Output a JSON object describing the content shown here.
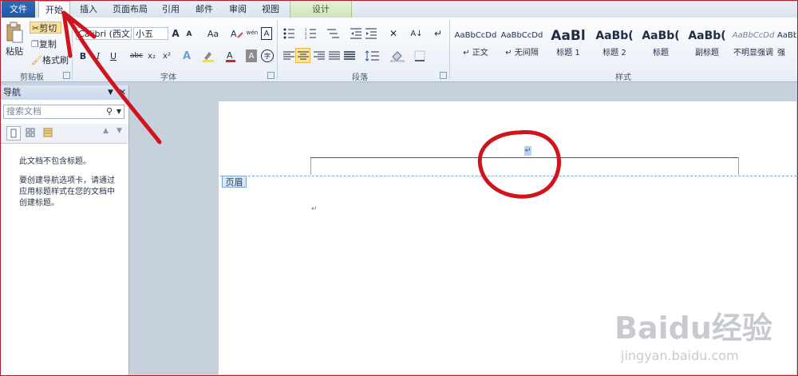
{
  "tabs": {
    "file": "文件",
    "home": "开始",
    "insert": "插入",
    "page_layout": "页面布局",
    "references": "引用",
    "mailings": "邮件",
    "review": "审阅",
    "view": "视图",
    "design": "设计"
  },
  "clipboard": {
    "paste": "粘贴",
    "cut": "剪切",
    "copy": "复制",
    "format_painter": "格式刷",
    "group": "剪贴板"
  },
  "font": {
    "name": "Calibri (西文正文)",
    "size": "小五",
    "bold": "B",
    "italic": "I",
    "underline": "U",
    "strike": "abc",
    "subscript": "x₂",
    "superscript": "x²",
    "grow": "A",
    "shrink": "A",
    "change_case": "Aa",
    "group": "字体"
  },
  "paragraph": {
    "group": "段落"
  },
  "styles": {
    "group": "样式",
    "items": [
      {
        "sample": "AaBbCcDd",
        "name": "↵ 正文"
      },
      {
        "sample": "AaBbCcDd",
        "name": "↵ 无间隔"
      },
      {
        "sample": "AaBl",
        "name": "标题 1"
      },
      {
        "sample": "AaBb(",
        "name": "标题 2"
      },
      {
        "sample": "AaBb(",
        "name": "标题"
      },
      {
        "sample": "AaBb(",
        "name": "副标题"
      },
      {
        "sample": "AaBbCcDd",
        "name": "不明显强调"
      },
      {
        "sample": "AaBb",
        "name": "强"
      }
    ]
  },
  "nav": {
    "title": "导航",
    "search_placeholder": "搜索文档",
    "no_headings": "此文档不包含标题。",
    "hint": "要创建导航选项卡，请通过应用标题样式在您的文档中创建标题。"
  },
  "document": {
    "header_label": "页眉",
    "para_mark": "↵"
  },
  "watermark": {
    "logo": "Baidu经验",
    "url": "jingyan.baidu.com"
  },
  "colors": {
    "file_tab": "#2a64b0",
    "annotation": "#d0141e",
    "header_dash": "#7aa6d6"
  }
}
